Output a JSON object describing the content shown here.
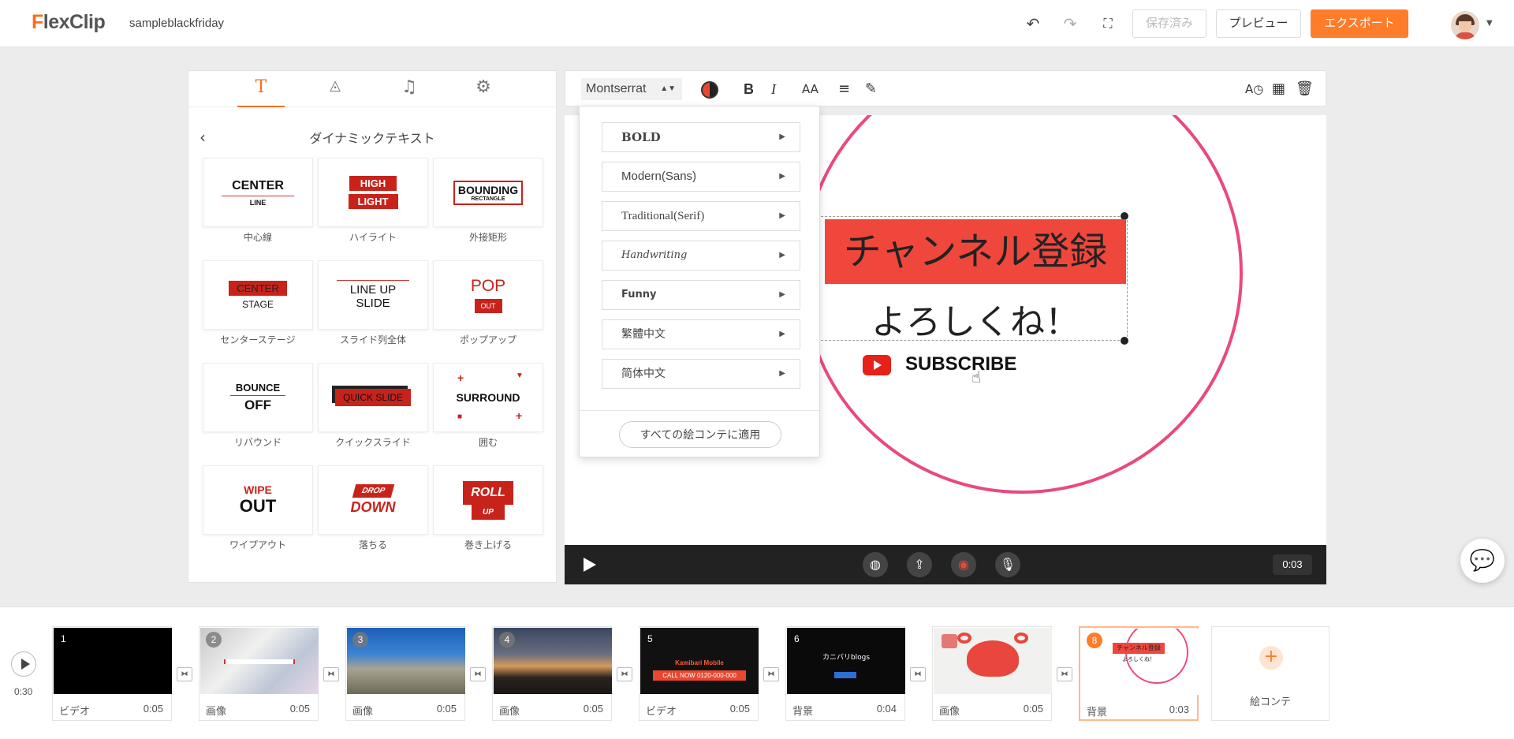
{
  "app": {
    "logo_f": "F",
    "logo_rest": "lexClip",
    "project_name": "sampleblackfriday"
  },
  "header": {
    "saved_label": "保存済み",
    "preview_label": "プレビュー",
    "export_label": "エクスポート"
  },
  "left_panel": {
    "title": "ダイナミックテキスト",
    "tiles": [
      {
        "label": "中心線",
        "line1": "CENTER",
        "line2": "LINE"
      },
      {
        "label": "ハイライト",
        "line1": "HIGH",
        "line2": "LIGHT"
      },
      {
        "label": "外接矩形",
        "line1": "BOUNDING",
        "line2": "RECTANGLE"
      },
      {
        "label": "センターステージ",
        "line1": "CENTER",
        "line2": "STAGE"
      },
      {
        "label": "スライド列全体",
        "line1": "LINE UP",
        "line2": "SLIDE"
      },
      {
        "label": "ポップアップ",
        "line1": "POP",
        "line2": "OUT"
      },
      {
        "label": "リバウンド",
        "line1": "BOUNCE",
        "line2": "OFF"
      },
      {
        "label": "クイックスライド",
        "line1": "QUICK SLIDE",
        "line2": ""
      },
      {
        "label": "囲む",
        "line1": "SURROUND",
        "line2": ""
      },
      {
        "label": "ワイプアウト",
        "line1": "WIPE",
        "line2": "OUT"
      },
      {
        "label": "落ちる",
        "line1": "DROP",
        "line2": "DOWN"
      },
      {
        "label": "巻き上げる",
        "line1": "ROLL",
        "line2": "UP"
      }
    ]
  },
  "toolbar": {
    "font": "Montserrat"
  },
  "font_dropdown": {
    "items": [
      "BOLD",
      "Modern(Sans)",
      "Traditional(Serif)",
      "Handwriting",
      "Funny",
      "繁體中文",
      "简体中文"
    ],
    "apply_label": "すべての絵コンテに適用"
  },
  "canvas": {
    "banner_text": "チャンネル登録",
    "subline": "よろしくね！",
    "subscribe": "SUBSCRIBE"
  },
  "playbar": {
    "time": "0:03"
  },
  "timeline": {
    "total": "0:30",
    "clips": [
      {
        "num": "1",
        "type": "ビデオ",
        "dur": "0:05"
      },
      {
        "num": "2",
        "type": "画像",
        "dur": "0:05"
      },
      {
        "num": "3",
        "type": "画像",
        "dur": "0:05"
      },
      {
        "num": "4",
        "type": "画像",
        "dur": "0:05"
      },
      {
        "num": "5",
        "type": "ビデオ",
        "dur": "0:05",
        "thumb_line1": "Kamibari Mobile",
        "thumb_line2": "CALL NOW 0120-000-000"
      },
      {
        "num": "6",
        "type": "背景",
        "dur": "0:04",
        "thumb_line1": "カニバリblogs"
      },
      {
        "num": "",
        "type": "画像",
        "dur": "0:05"
      },
      {
        "num": "8",
        "type": "背景",
        "dur": "0:03",
        "thumb_line1": "チャンネル登録",
        "thumb_line2": "よろしくね！"
      }
    ],
    "add_label": "絵コンテ"
  },
  "colors": {
    "accent": "#ff7c2a",
    "banner": "#f0473d",
    "ring": "#ea4a7b"
  }
}
